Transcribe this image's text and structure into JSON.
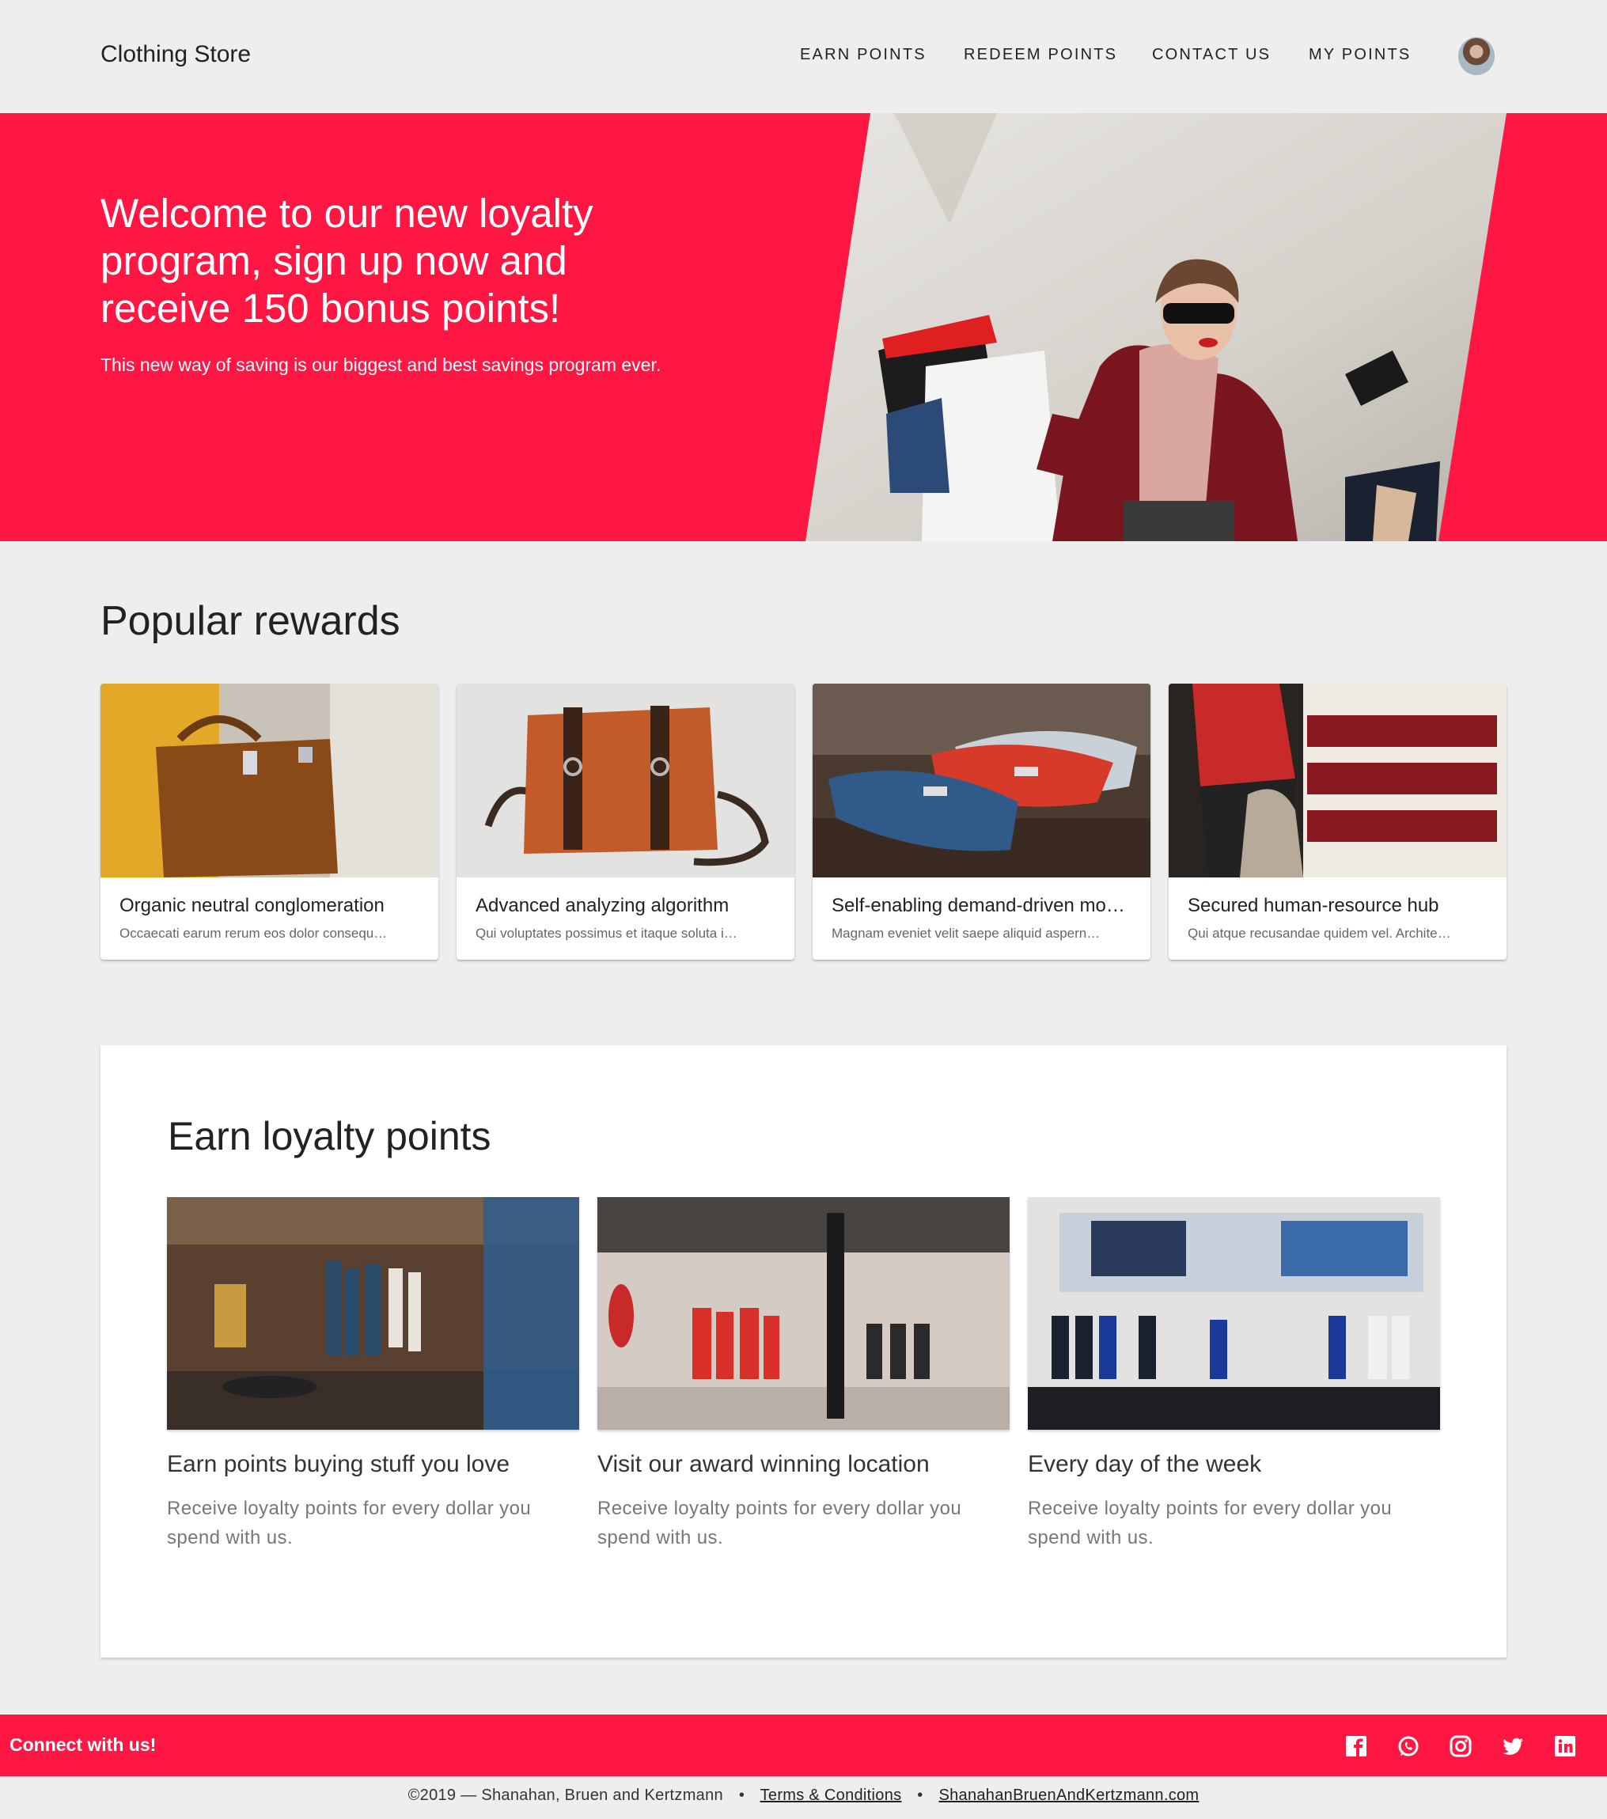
{
  "header": {
    "brand": "Clothing Store",
    "nav": [
      "EARN POINTS",
      "REDEEM POINTS",
      "CONTACT US",
      "MY POINTS"
    ]
  },
  "hero": {
    "title": "Welcome to our new loyalty program, sign up now and receive 150 bonus points!",
    "subtitle": "This new way of saving is our biggest and best savings program ever."
  },
  "rewards": {
    "title": "Popular rewards",
    "items": [
      {
        "title": "Organic neutral conglomeration",
        "desc": "Occaecati earum rerum eos dolor consequ…"
      },
      {
        "title": "Advanced analyzing algorithm",
        "desc": "Qui voluptates possimus et itaque soluta i…"
      },
      {
        "title": "Self-enabling demand-driven mo…",
        "desc": "Magnam eveniet velit saepe aliquid aspern…"
      },
      {
        "title": "Secured human-resource hub",
        "desc": "Qui atque recusandae quidem vel. Archite…"
      }
    ]
  },
  "earn": {
    "title": "Earn loyalty points",
    "items": [
      {
        "title": "Earn points buying stuff you love",
        "text": "Receive loyalty points for every dollar you spend with us."
      },
      {
        "title": "Visit our award winning location",
        "text": "Receive loyalty points for every dollar you spend with us."
      },
      {
        "title": "Every day of the week",
        "text": "Receive loyalty points for every dollar you spend with us."
      }
    ]
  },
  "footer": {
    "connect": "Connect with us!",
    "social_icons": [
      "facebook-icon",
      "whatsapp-icon",
      "instagram-icon",
      "twitter-icon",
      "linkedin-icon"
    ],
    "copyright": "©2019 — Shanahan, Bruen and Kertzmann",
    "separator": "•",
    "terms": "Terms & Conditions",
    "site": "ShanahanBruenAndKertzmann.com"
  },
  "colors": {
    "accent": "#ff1744",
    "background": "#eeeeee"
  }
}
